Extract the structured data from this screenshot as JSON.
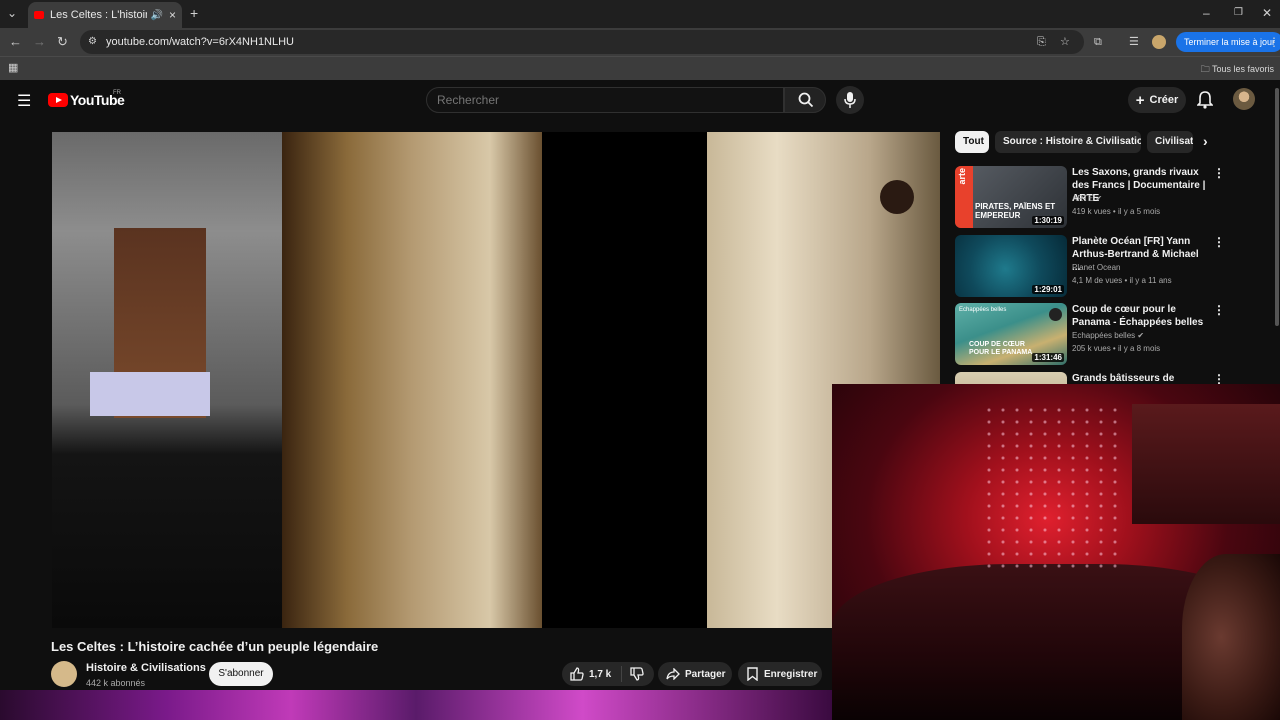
{
  "browser": {
    "tab_title": "Les Celtes : L'histoire cachée",
    "url": "youtube.com/watch?v=6rX4NH1NLHU",
    "update_button": "Terminer la mise à jour",
    "bookmarks_label": "Tous les favoris"
  },
  "masthead": {
    "logo": "YouTube",
    "country": "FR",
    "search_placeholder": "Rechercher",
    "create_label": "Créer"
  },
  "video": {
    "title": "Les Celtes : L’histoire cachée d’un peuple légendaire",
    "channel": "Histoire & Civilisations",
    "subscribers": "442 k abonnés",
    "subscribe_label": "S'abonner",
    "likes": "1,7 k",
    "share_label": "Partager",
    "save_label": "Enregistrer"
  },
  "chips": [
    "Tout",
    "Source : Histoire & Civilisations",
    "Civilisati"
  ],
  "recommendations": [
    {
      "title": "Les Saxons, grands rivaux des Francs | Documentaire | ARTE",
      "channel": "ARTE",
      "verified": true,
      "meta": "419 k vues • il y a 5 mois",
      "duration": "1:30:19",
      "thumb_text": "PIRATES, PAÏENS ET EMPEREUR",
      "thumb_brand": "arte",
      "thumb_color": "#3a3f45"
    },
    {
      "title": "Planète Océan [FR] Yann Arthus-Bertrand & Michael ...",
      "channel": "Planet Ocean",
      "verified": false,
      "meta": "4,1 M de vues • il y a 11 ans",
      "duration": "1:29:01",
      "thumb_text": "",
      "thumb_brand": "",
      "thumb_color": "#0f4a5c"
    },
    {
      "title": "Coup de cœur pour le Panama - Échappées belles",
      "channel": "Echappées belles",
      "verified": true,
      "meta": "205 k vues • il y a 8 mois",
      "duration": "1:31:46",
      "thumb_text": "COUP DE CŒUR POUR LE PANAMA",
      "thumb_brand": "Echappées belles",
      "thumb_color": "#3b8f8a"
    },
    {
      "title": "Grands bâtisseurs de France :",
      "channel": "",
      "verified": false,
      "meta": "",
      "duration": "",
      "thumb_text": "",
      "thumb_brand": "",
      "thumb_color": "#b8a98a"
    }
  ]
}
